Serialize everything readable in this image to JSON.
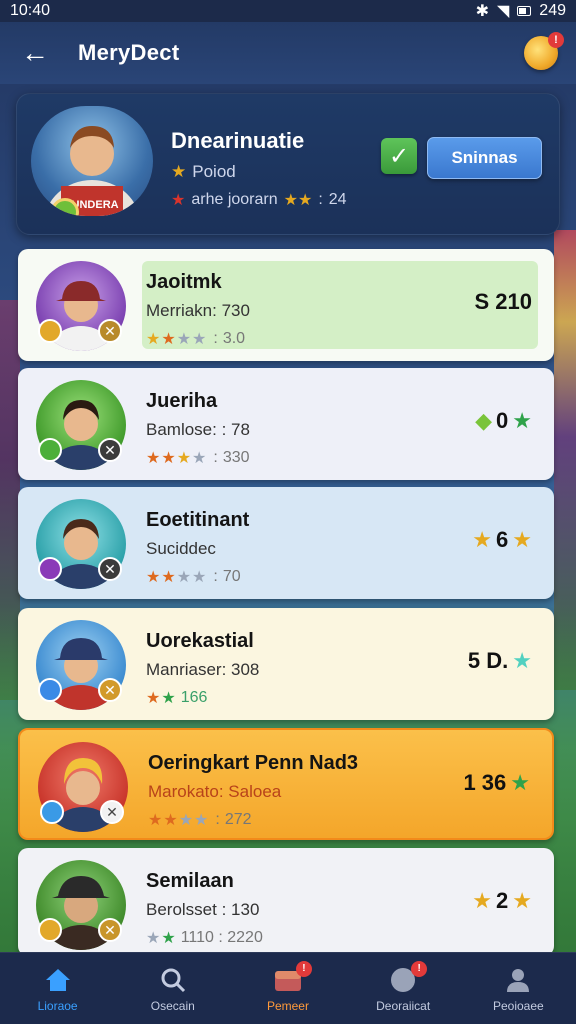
{
  "status_bar": {
    "time": "10:40",
    "battery_text": "249"
  },
  "app_bar": {
    "title": "MeryDect",
    "coin_badge": "!"
  },
  "profile": {
    "name": "Dnearinuatie",
    "subtitle": "Poiod",
    "rank_text": "arhe joorarn",
    "rank_count": "24",
    "action_label": "Sninnas"
  },
  "players": [
    {
      "name": "Jaoitmk",
      "subtitle": "Merriakn: 730",
      "rating": "3.0",
      "score": "S 210",
      "card_bg": "#eef6ea",
      "highlight": true
    },
    {
      "name": "Jueriha",
      "subtitle": "Bamlose: : 78",
      "rating": "330",
      "score": "0",
      "card_bg": "#eef0f8"
    },
    {
      "name": "Eoetitinant",
      "subtitle": "Suciddec",
      "rating": "70",
      "score": "6",
      "card_bg": "#d7e7f5"
    },
    {
      "name": "Uorekastial",
      "subtitle": "Manriaser: 308",
      "rating": "166",
      "score": "5 D.",
      "card_bg": "#fbf6e0"
    },
    {
      "name": "Oeringkart Penn Nad3",
      "subtitle": "Marokato: Saloea",
      "rating": "272",
      "score": "1 36",
      "card_bg": "#f8b53c"
    },
    {
      "name": "Semilaan",
      "subtitle": "Berolsset : 130",
      "rating": "1110 : 2220",
      "score": "2",
      "card_bg": "#f1f2f6"
    }
  ],
  "bottom_nav": [
    {
      "label": "Lioraoe",
      "icon": "home-icon"
    },
    {
      "label": "Osecain",
      "icon": "search-icon"
    },
    {
      "label": "Pemeer",
      "icon": "inbox-icon",
      "badge": "!"
    },
    {
      "label": "Deoraiicat",
      "icon": "chat-icon",
      "badge": "!"
    },
    {
      "label": "Peoioaee",
      "icon": "profile-icon"
    }
  ],
  "colors": {
    "accent": "#3aa0ff",
    "highlight": "#f8b53c",
    "app_bar": "#233a66"
  }
}
